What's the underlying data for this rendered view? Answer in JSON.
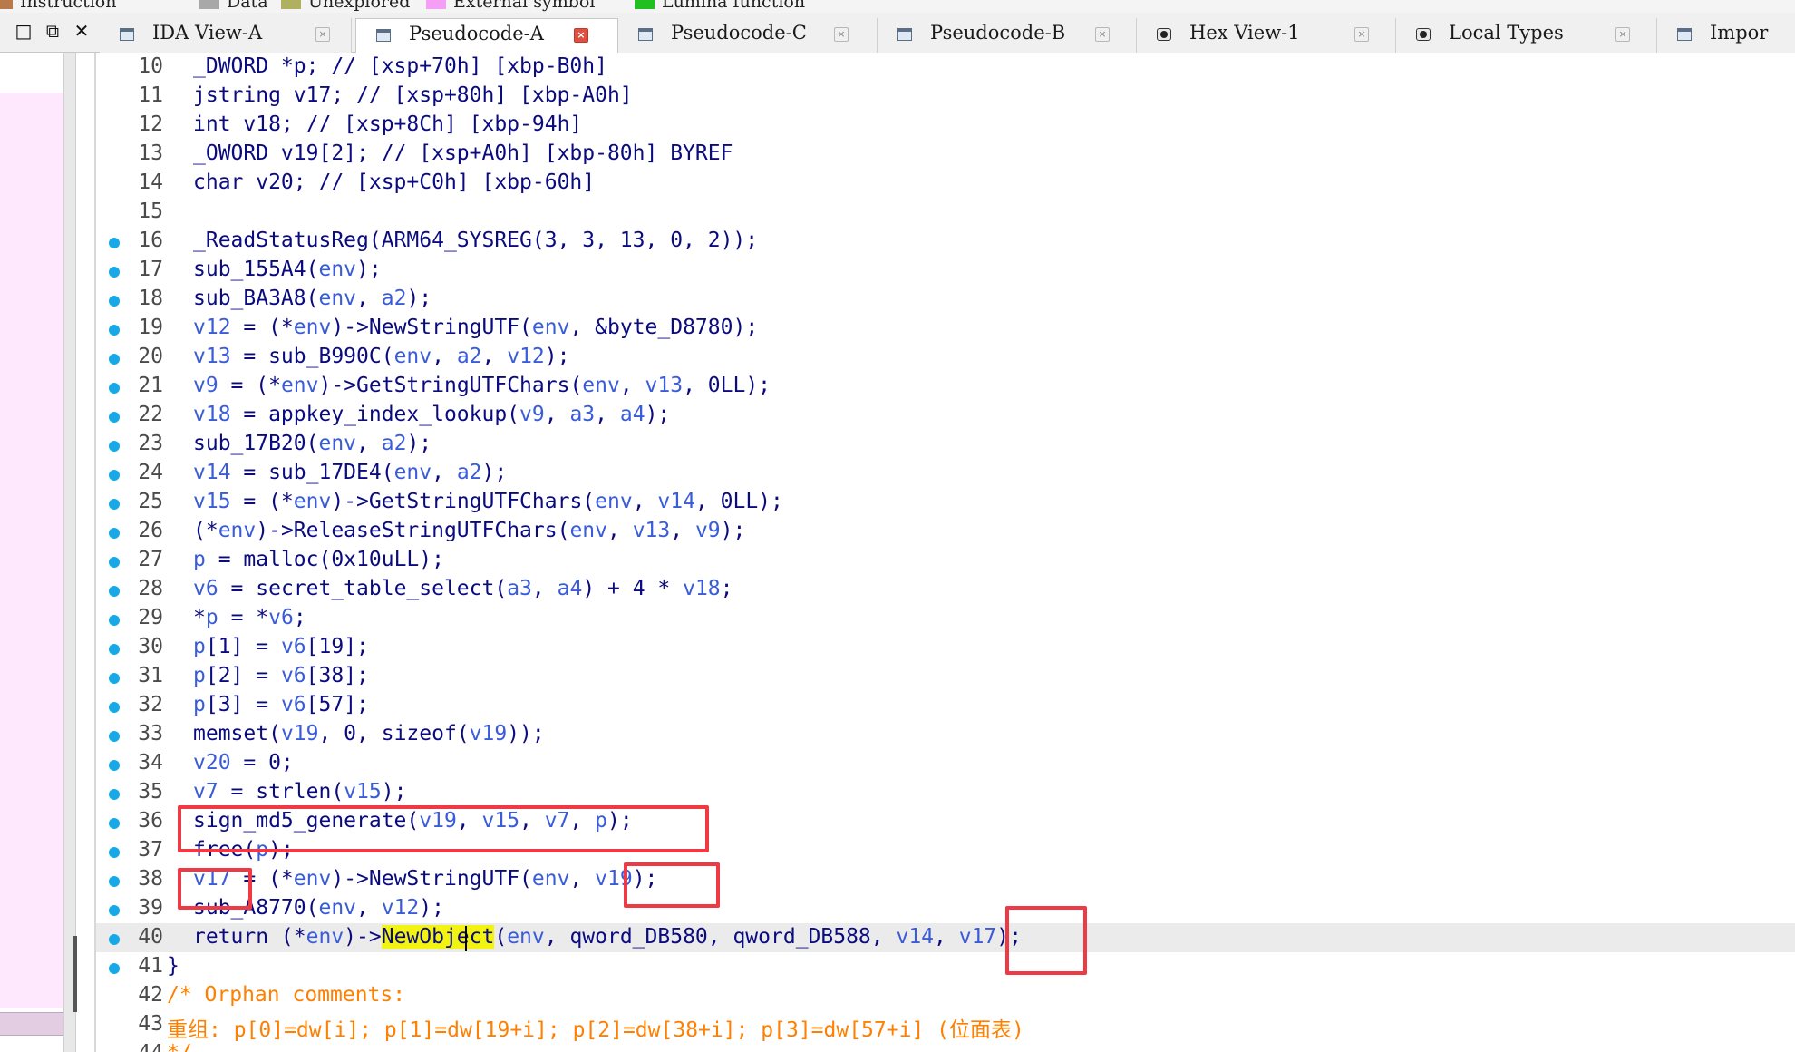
{
  "legend": [
    {
      "label": "Instruction",
      "color": "#b87a4b"
    },
    {
      "label": "Data",
      "color": "#a8a8a8"
    },
    {
      "label": "Unexplored",
      "color": "#b0b060"
    },
    {
      "label": "External symbol",
      "color": "#f59ef5"
    },
    {
      "label": "Lumina function",
      "color": "#20c020"
    }
  ],
  "window_buttons": {
    "restore": "□",
    "maximize": "⧉",
    "close": "✕"
  },
  "tabs": [
    {
      "label": "IDA View-A",
      "icon": "listing-icon",
      "active": false
    },
    {
      "label": "Pseudocode-A",
      "icon": "pseudocode-icon",
      "active": true
    },
    {
      "label": "Pseudocode-C",
      "icon": "pseudocode-icon",
      "active": false
    },
    {
      "label": "Pseudocode-B",
      "icon": "pseudocode-icon",
      "active": false
    },
    {
      "label": "Hex View-1",
      "icon": "hex-icon",
      "active": false
    },
    {
      "label": "Local Types",
      "icon": "types-icon",
      "active": false
    },
    {
      "label": "Impor",
      "icon": "imports-icon",
      "active": false
    }
  ],
  "close_glyph": "×",
  "code": {
    "current_line": 40,
    "lines": [
      {
        "num": "10",
        "text": "_DWORD *p; // [xsp+70h] [xbp-B0h]",
        "bp": false
      },
      {
        "num": "11",
        "text": "jstring v17; // [xsp+80h] [xbp-A0h]",
        "bp": false
      },
      {
        "num": "12",
        "text": "int v18; // [xsp+8Ch] [xbp-94h]",
        "bp": false
      },
      {
        "num": "13",
        "text": "_OWORD v19[2]; // [xsp+A0h] [xbp-80h] BYREF",
        "bp": false
      },
      {
        "num": "14",
        "text": "char v20; // [xsp+C0h] [xbp-60h]",
        "bp": false
      },
      {
        "num": "15",
        "text": "",
        "bp": false
      },
      {
        "num": "16",
        "text": "_ReadStatusReg(ARM64_SYSREG(3, 3, 13, 0, 2));",
        "bp": true
      },
      {
        "num": "17",
        "text": "sub_155A4(env);",
        "bp": true
      },
      {
        "num": "18",
        "text": "sub_BA3A8(env, a2);",
        "bp": true
      },
      {
        "num": "19",
        "text": "v12 = (*env)->NewStringUTF(env, &byte_D8780);",
        "bp": true
      },
      {
        "num": "20",
        "text": "v13 = sub_B990C(env, a2, v12);",
        "bp": true
      },
      {
        "num": "21",
        "text": "v9 = (*env)->GetStringUTFChars(env, v13, 0LL);",
        "bp": true
      },
      {
        "num": "22",
        "text": "v18 = appkey_index_lookup(v9, a3, a4);",
        "bp": true
      },
      {
        "num": "23",
        "text": "sub_17B20(env, a2);",
        "bp": true
      },
      {
        "num": "24",
        "text": "v14 = sub_17DE4(env, a2);",
        "bp": true
      },
      {
        "num": "25",
        "text": "v15 = (*env)->GetStringUTFChars(env, v14, 0LL);",
        "bp": true
      },
      {
        "num": "26",
        "text": "(*env)->ReleaseStringUTFChars(env, v13, v9);",
        "bp": true
      },
      {
        "num": "27",
        "text": "p = malloc(0x10uLL);",
        "bp": true
      },
      {
        "num": "28",
        "text": "v6 = secret_table_select(a3, a4) + 4 * v18;",
        "bp": true
      },
      {
        "num": "29",
        "text": "*p = *v6;",
        "bp": true
      },
      {
        "num": "30",
        "text": "p[1] = v6[19];",
        "bp": true
      },
      {
        "num": "31",
        "text": "p[2] = v6[38];",
        "bp": true
      },
      {
        "num": "32",
        "text": "p[3] = v6[57];",
        "bp": true
      },
      {
        "num": "33",
        "text": "memset(v19, 0, sizeof(v19));",
        "bp": true
      },
      {
        "num": "34",
        "text": "v20 = 0;",
        "bp": true
      },
      {
        "num": "35",
        "text": "v7 = strlen(v15);",
        "bp": true
      },
      {
        "num": "36",
        "text": "sign_md5_generate(v19, v15, v7, p);",
        "bp": true
      },
      {
        "num": "37",
        "text": "free(p);",
        "bp": true
      },
      {
        "num": "38",
        "text": "v17 = (*env)->NewStringUTF(env, v19);",
        "bp": true
      },
      {
        "num": "39",
        "text": "sub_A8770(env, v12);",
        "bp": true
      },
      {
        "num": "40",
        "text": "return (*env)->NewObject(env, qword_DB580, qword_DB588, v14, v17);",
        "bp": true
      },
      {
        "num": "41",
        "text": "}",
        "bp": true,
        "outdent": true
      },
      {
        "num": "42",
        "text": "/* Orphan comments:",
        "bp": false,
        "outdent": true,
        "comment": true
      },
      {
        "num": "43",
        "text": "重组: p[0]=dw[i]; p[1]=dw[19+i]; p[2]=dw[38+i]; p[3]=dw[57+i] (位面表)",
        "bp": false,
        "outdent": true,
        "comment": true
      },
      {
        "num": "44",
        "text": "*/",
        "bp": false,
        "outdent": true,
        "comment": true
      }
    ]
  },
  "highlighted_token": "NewObject",
  "colors": {
    "code_text": "#0b0b80",
    "variable": "#3a5cd8",
    "comment": "#ff8000",
    "breakpoint": "#16a8e8",
    "annotation_box": "#ef3a45",
    "highlight": "#f3f312"
  }
}
